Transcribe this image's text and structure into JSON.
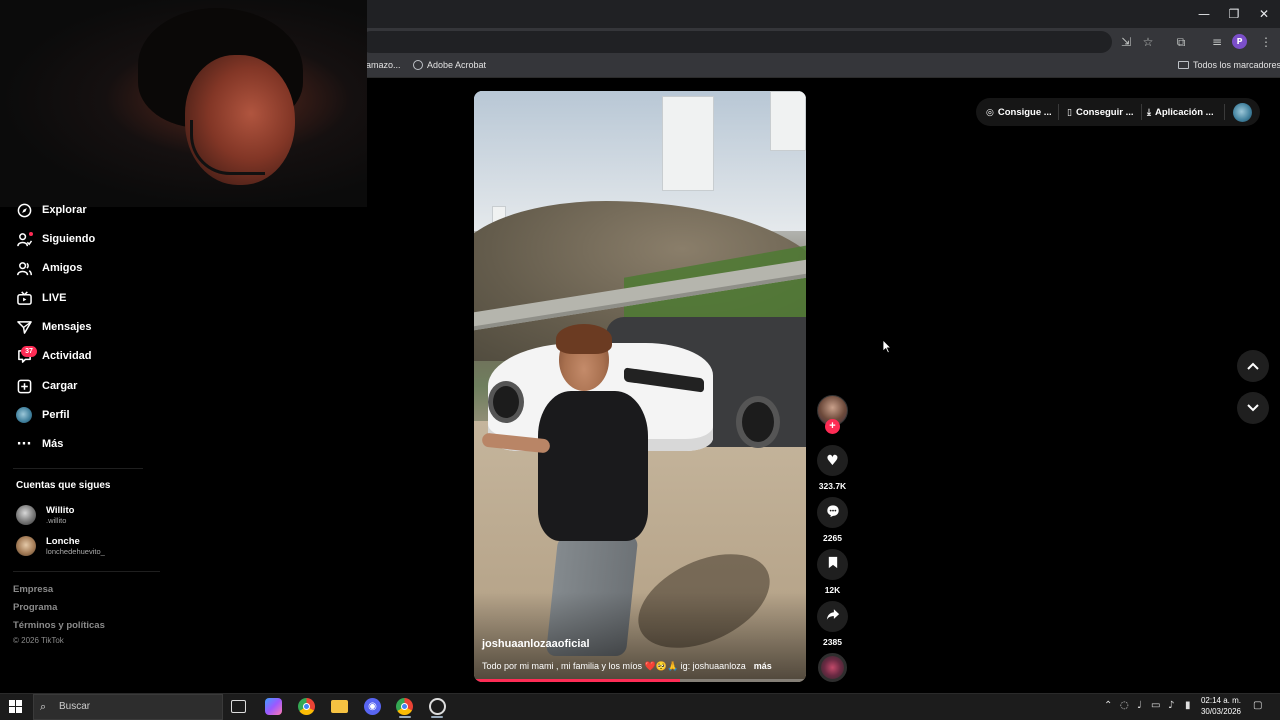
{
  "browser": {
    "window_controls": {
      "minimize": "—",
      "restore": "❐",
      "close": "✕"
    },
    "bookmarks": [
      {
        "label": "amazo..."
      },
      {
        "label": "Adobe Acrobat"
      }
    ],
    "all_bookmarks_label": "Todos los marcadores",
    "profile_initial": "P"
  },
  "sidebar": {
    "nav": [
      {
        "label": "Explorar",
        "icon": "compass-icon"
      },
      {
        "label": "Siguiendo",
        "icon": "following-icon"
      },
      {
        "label": "Amigos",
        "icon": "friends-icon"
      },
      {
        "label": "LIVE",
        "icon": "live-tv-icon"
      },
      {
        "label": "Mensajes",
        "icon": "send-icon"
      },
      {
        "label": "Actividad",
        "icon": "activity-icon"
      },
      {
        "label": "Cargar",
        "icon": "upload-icon"
      },
      {
        "label": "Perfil",
        "icon": "profile-avatar"
      },
      {
        "label": "Más",
        "icon": "more-dots-icon"
      }
    ],
    "activity_badge": "37",
    "following_section_title": "Cuentas que sigues",
    "following": [
      {
        "name": "Willito",
        "handle": ".willito"
      },
      {
        "name": "Lonche",
        "handle": "lonchedehuevito_"
      }
    ],
    "footer": {
      "links": [
        "Empresa",
        "Programa",
        "Términos y políticas"
      ],
      "copyright": "© 2026 TikTok"
    }
  },
  "video": {
    "author": "joshuaanlozaaoficial",
    "caption": "Todo por mi mami , mi familia y los míos ❤️🥺🙏 ig: joshuaanloza",
    "more_label": "más",
    "progress": 0.62
  },
  "actions": {
    "follow_plus": "+",
    "likes": "323.7K",
    "comments": "2265",
    "saves": "12K",
    "shares": "2385"
  },
  "top_bar": {
    "items": [
      {
        "label": "Consigue ...",
        "icon": "coin-icon"
      },
      {
        "label": "Conseguir ...",
        "icon": "phone-icon"
      },
      {
        "label": "Aplicación ...",
        "icon": "download-icon"
      }
    ]
  },
  "taskbar": {
    "search_placeholder": "Buscar",
    "time": "02:14 a. m.",
    "date": "30/03/2026"
  }
}
